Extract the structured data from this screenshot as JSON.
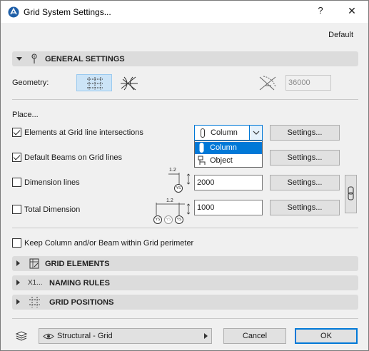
{
  "window": {
    "title": "Grid System Settings...",
    "help": "?",
    "close": "✕",
    "preset": "Default"
  },
  "general": {
    "header": "GENERAL SETTINGS",
    "geometry_label": "Geometry:",
    "angle_value": "36000"
  },
  "place": {
    "label": "Place...",
    "row1_label": "Elements at Grid line intersections",
    "row1_checked": true,
    "element_type": "Column",
    "row2_label": "Default Beams on Grid lines",
    "row2_checked": true,
    "row3_label": "Dimension lines",
    "row3_checked": false,
    "row3_value": "2000",
    "row4_label": "Total Dimension",
    "row4_checked": false,
    "row4_value": "1000",
    "settings_label": "Settings...",
    "dim_small_label": "1.2",
    "dim_circle": "YS"
  },
  "dropdown": {
    "options": [
      "Column",
      "Object"
    ],
    "selected": "Column"
  },
  "keep": {
    "label": "Keep Column and/or Beam within Grid perimeter",
    "checked": false
  },
  "sections": {
    "grid_elements": "GRID ELEMENTS",
    "naming_rules": "NAMING RULES",
    "naming_prefix": "X1...",
    "grid_positions": "GRID POSITIONS"
  },
  "footer": {
    "layer": "Structural - Grid",
    "cancel": "Cancel",
    "ok": "OK"
  },
  "colors": {
    "accent": "#0078d7",
    "section_bg": "#dcdcdc",
    "dialog_bg": "#f0f0f0"
  }
}
